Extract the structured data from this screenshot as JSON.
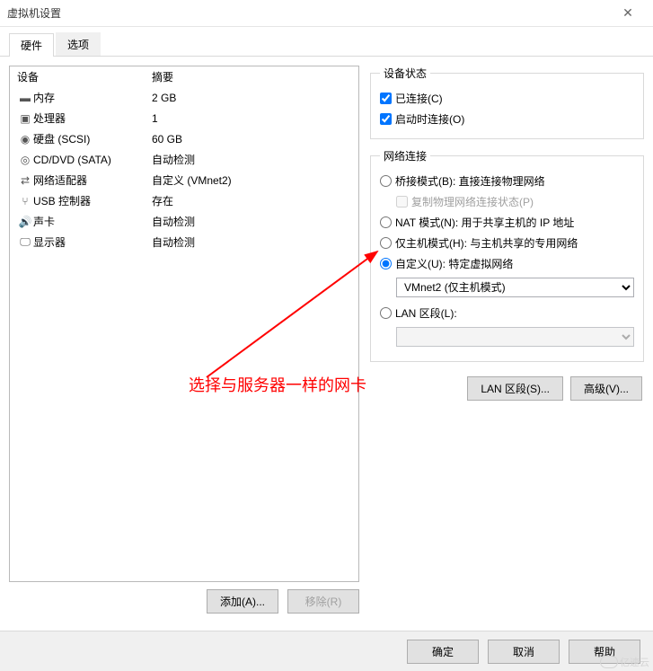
{
  "window": {
    "title": "虚拟机设置"
  },
  "tabs": {
    "hardware": "硬件",
    "options": "选项"
  },
  "deviceList": {
    "header": {
      "device": "设备",
      "summary": "摘要"
    },
    "items": [
      {
        "name": "内存",
        "summary": "2 GB",
        "icon": "memory"
      },
      {
        "name": "处理器",
        "summary": "1",
        "icon": "cpu"
      },
      {
        "name": "硬盘 (SCSI)",
        "summary": "60 GB",
        "icon": "disk"
      },
      {
        "name": "CD/DVD (SATA)",
        "summary": "自动检测",
        "icon": "cd"
      },
      {
        "name": "网络适配器",
        "summary": "自定义 (VMnet2)",
        "icon": "network"
      },
      {
        "name": "USB 控制器",
        "summary": "存在",
        "icon": "usb"
      },
      {
        "name": "声卡",
        "summary": "自动检测",
        "icon": "sound"
      },
      {
        "name": "显示器",
        "summary": "自动检测",
        "icon": "display"
      }
    ],
    "addBtn": "添加(A)...",
    "removeBtn": "移除(R)"
  },
  "deviceStatus": {
    "legend": "设备状态",
    "connected": "已连接(C)",
    "connectOnPower": "启动时连接(O)"
  },
  "netConn": {
    "legend": "网络连接",
    "bridged": "桥接模式(B): 直接连接物理网络",
    "replicate": "复制物理网络连接状态(P)",
    "nat": "NAT 模式(N): 用于共享主机的 IP 地址",
    "hostOnly": "仅主机模式(H): 与主机共享的专用网络",
    "custom": "自定义(U): 特定虚拟网络",
    "customSelected": "VMnet2 (仅主机模式)",
    "lanSegment": "LAN 区段(L):",
    "lanBtn": "LAN 区段(S)...",
    "advBtn": "高级(V)..."
  },
  "footer": {
    "ok": "确定",
    "cancel": "取消",
    "help": "帮助"
  },
  "annotation": "选择与服务器一样的网卡",
  "watermark": "亿速云"
}
